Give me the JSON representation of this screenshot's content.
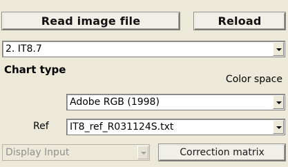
{
  "buttons": {
    "read_image": "Read image file",
    "reload": "Reload",
    "correction": "Correction matrix"
  },
  "target_select": {
    "value": "2. IT8.7"
  },
  "chart_type": {
    "label": "Chart type"
  },
  "color_space": {
    "label": "Color space",
    "value": "Adobe RGB (1998)"
  },
  "ref": {
    "label": "Ref",
    "value": "IT8_ref_R031124S.txt"
  },
  "display_select": {
    "value": "Display Input"
  }
}
